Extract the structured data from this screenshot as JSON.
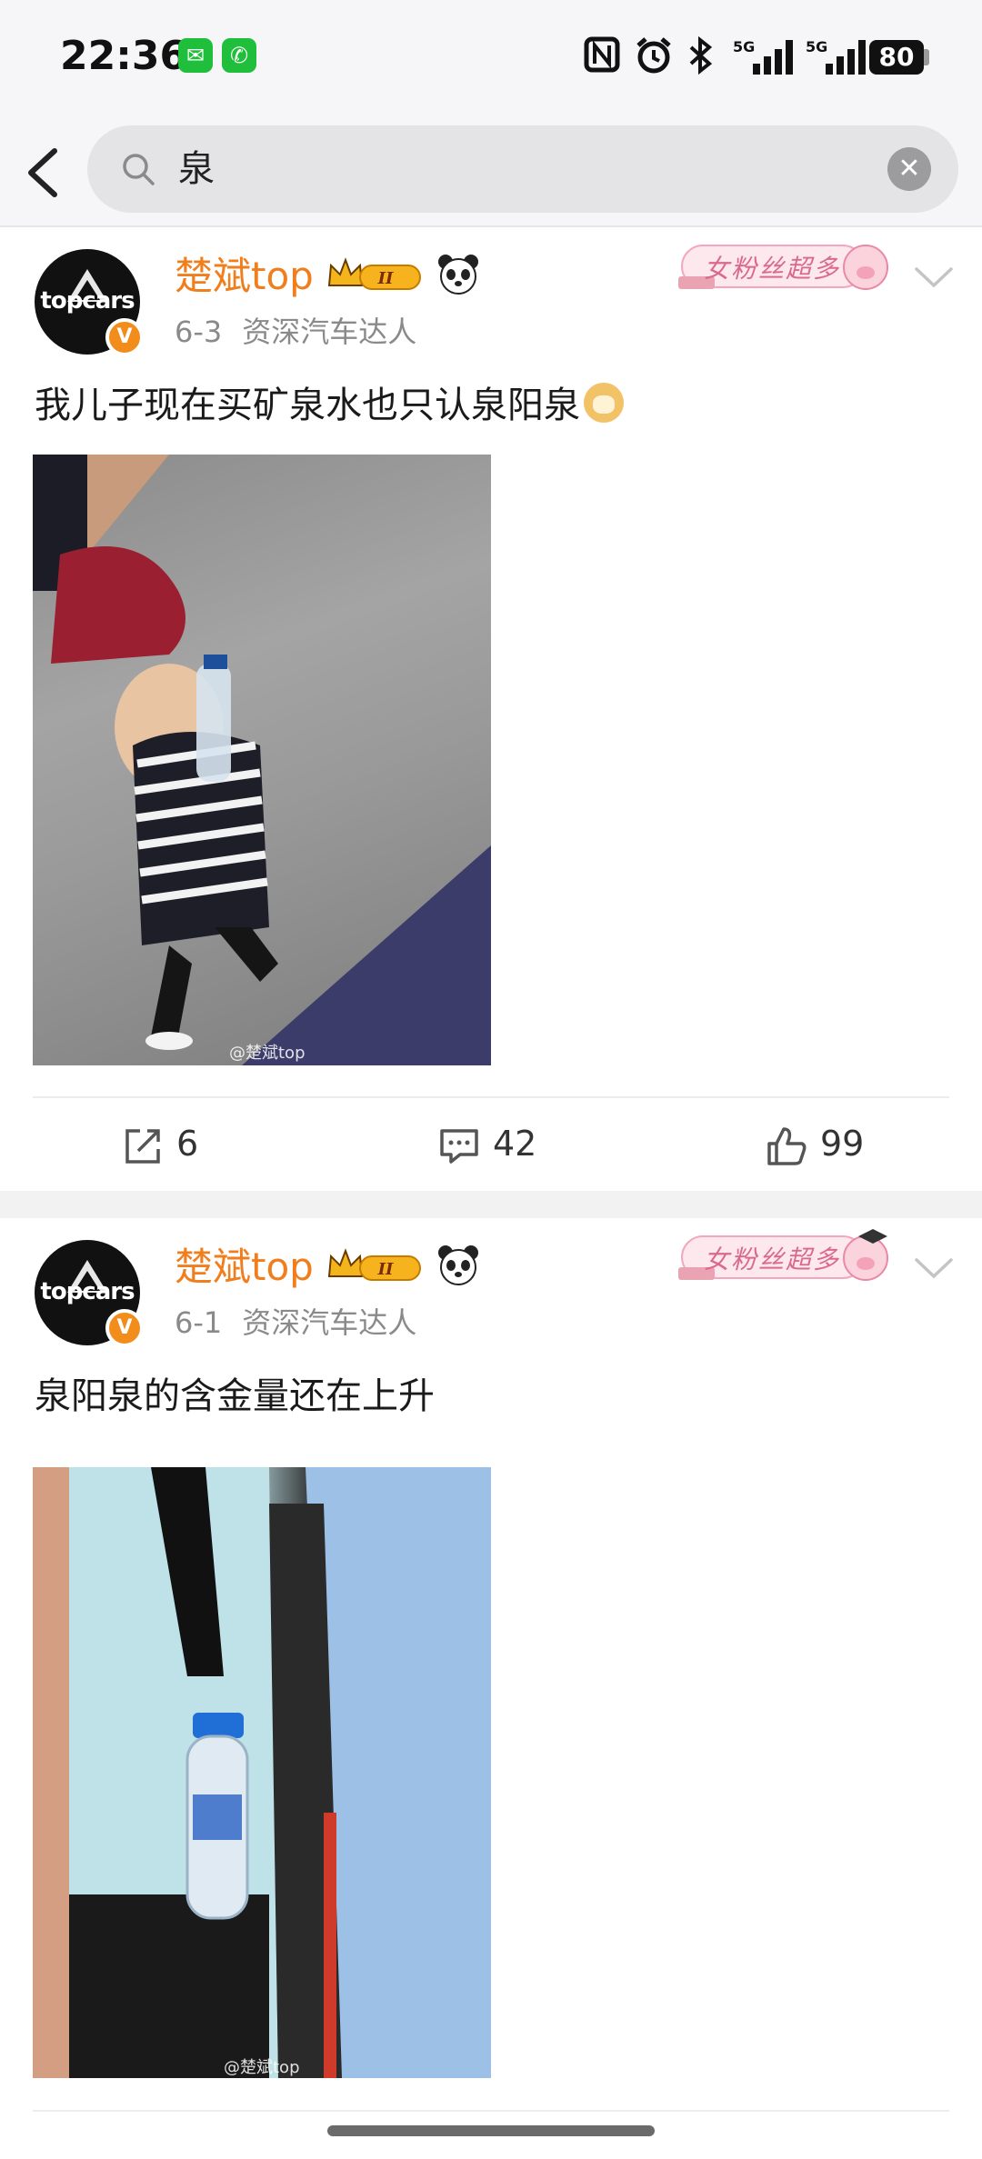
{
  "status_bar": {
    "time": "22:36",
    "icons": [
      "wechat-icon",
      "phone-icon",
      "nfc-icon",
      "alarm-icon",
      "bluetooth-icon",
      "signal-icon",
      "signal-icon",
      "battery-icon"
    ],
    "network1": "5G",
    "network2": "5G",
    "battery": "80"
  },
  "search": {
    "query": "泉",
    "icons": [
      "back-icon",
      "search-icon",
      "clear-icon"
    ]
  },
  "posts": [
    {
      "username": "楚斌top",
      "date": "6-3",
      "tag": "资深汽车达人",
      "fan_badge": "女粉丝超多",
      "text": "我儿子现在买矿泉水也只认泉阳泉",
      "watermark": "@楚斌top",
      "reposts": "6",
      "comments": "42",
      "likes": "99"
    },
    {
      "username": "楚斌top",
      "date": "6-1",
      "tag": "资深汽车达人",
      "fan_badge": "女粉丝超多",
      "text": "泉阳泉的含金量还在上升",
      "watermark": "@楚斌top"
    }
  ],
  "avatar_text": "topcars",
  "verified_mark": "V",
  "level_badge": "II",
  "colors": {
    "username": "#f07e1c",
    "verified": "#f28c1a",
    "meta": "#8a8a8a",
    "background": "#f6f6f8"
  }
}
